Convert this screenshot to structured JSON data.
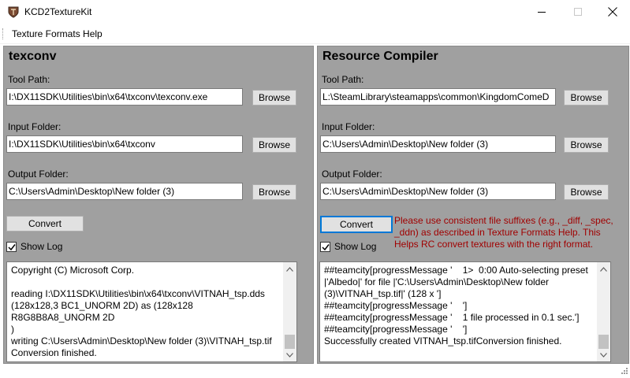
{
  "window": {
    "title": "KCD2TextureKit",
    "icon": "app-shield-icon"
  },
  "menu": {
    "items": [
      {
        "label": "Texture Formats Help"
      }
    ]
  },
  "texconv": {
    "title": "texconv",
    "tool_path_label": "Tool Path:",
    "tool_path_value": "I:\\DX11SDK\\Utilities\\bin\\x64\\txconv\\texconv.exe",
    "input_label": "Input Folder:",
    "input_value": "I:\\DX11SDK\\Utilities\\bin\\x64\\txconv",
    "output_label": "Output Folder:",
    "output_value": "C:\\Users\\Admin\\Desktop\\New folder (3)",
    "browse_label": "Browse",
    "convert_label": "Convert",
    "show_log_label": "Show Log",
    "show_log_checked": true,
    "log_text": "Copyright (C) Microsoft Corp.\n\nreading I:\\DX11SDK\\Utilities\\bin\\x64\\txconv\\VITNAH_tsp.dds\n(128x128,3 BC1_UNORM 2D) as (128x128 R8G8B8A8_UNORM 2D\n)\nwriting C:\\Users\\Admin\\Desktop\\New folder (3)\\VITNAH_tsp.tif\nConversion finished."
  },
  "rc": {
    "title": "Resource Compiler",
    "tool_path_label": "Tool Path:",
    "tool_path_value": "L:\\SteamLibrary\\steamapps\\common\\KingdomComeD",
    "input_label": "Input Folder:",
    "input_value": "C:\\Users\\Admin\\Desktop\\New folder (3)",
    "output_label": "Output Folder:",
    "output_value": "C:\\Users\\Admin\\Desktop\\New folder (3)",
    "browse_label": "Browse",
    "convert_label": "Convert",
    "warning": "Please use consistent file suffixes (e.g., _diff, _spec, _ddn) as described in Texture Formats Help. This Helps RC convert textures with the right format.",
    "show_log_label": "Show Log",
    "show_log_checked": true,
    "log_text": "##teamcity[progressMessage '    1>  0:00 Auto-selecting preset\n|'Albedo|' for file |'C:\\Users\\Admin\\Desktop\\New folder\n(3)\\VITNAH_tsp.tif|' (128 x ']\n##teamcity[progressMessage '    ']\n##teamcity[progressMessage '    1 file processed in 0.1 sec.']\n##teamcity[progressMessage '    ']\nSuccessfully created VITNAH_tsp.tifConversion finished."
  },
  "colors": {
    "panel_bg": "#a0a0a0",
    "warning_text": "#a00000",
    "focus_border": "#0078d7"
  }
}
